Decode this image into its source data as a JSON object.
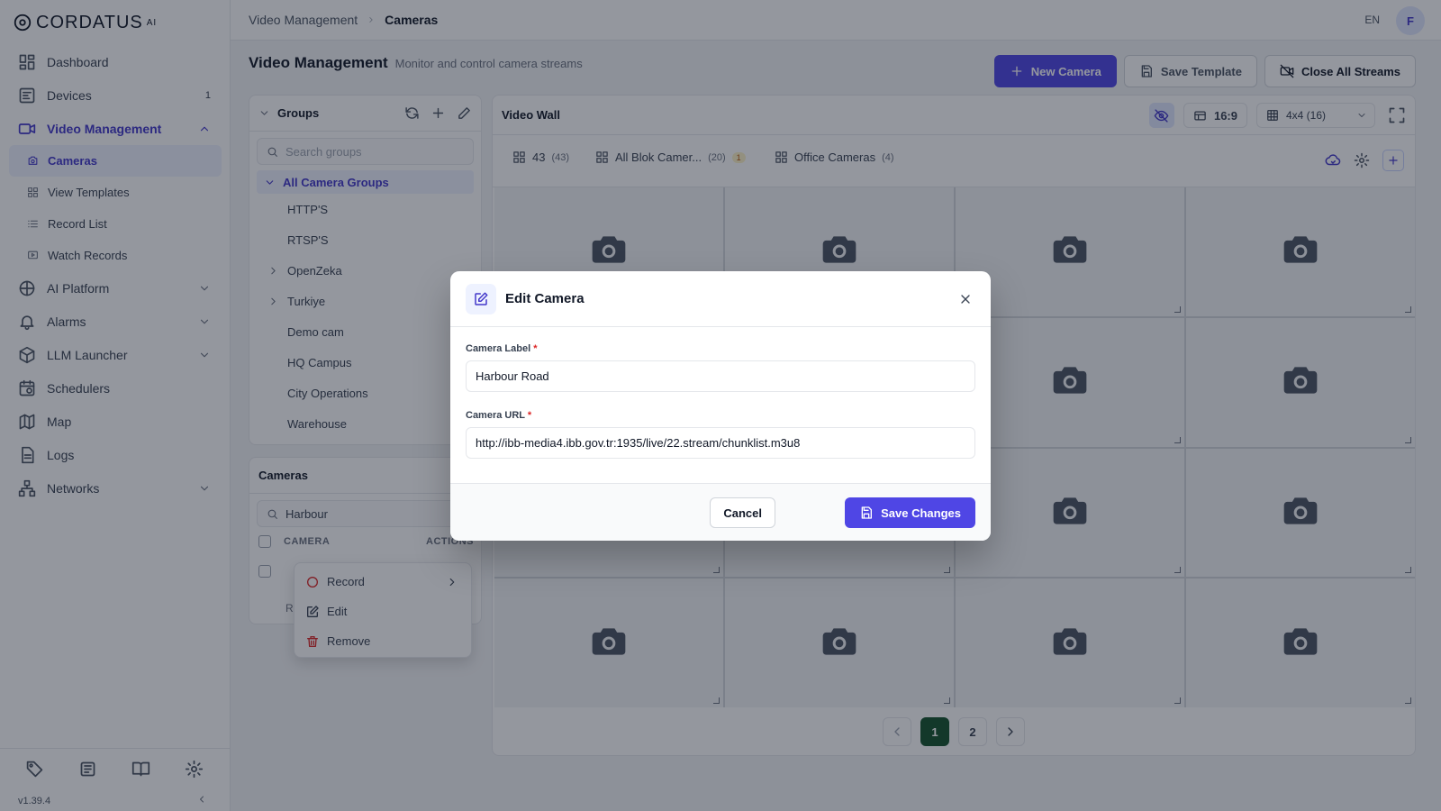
{
  "brand": {
    "name": "CORDATUS",
    "sup": "AI",
    "version": "v1.39.4"
  },
  "sidebar": {
    "items": [
      {
        "label": "Dashboard",
        "icon": "dashboard-icon"
      },
      {
        "label": "Devices",
        "icon": "devices-icon",
        "badge": "1"
      },
      {
        "label": "Video Management",
        "icon": "video-icon",
        "expanded": true,
        "children": [
          {
            "label": "Cameras",
            "icon": "camera-icon",
            "active": true
          },
          {
            "label": "View Templates",
            "icon": "grid-icon"
          },
          {
            "label": "Record List",
            "icon": "list-icon"
          },
          {
            "label": "Watch Records",
            "icon": "play-icon"
          }
        ]
      },
      {
        "label": "AI Platform",
        "icon": "brain-icon"
      },
      {
        "label": "Alarms",
        "icon": "bell-icon"
      },
      {
        "label": "LLM Launcher",
        "icon": "box-icon"
      },
      {
        "label": "Schedulers",
        "icon": "calendar-clock-icon"
      },
      {
        "label": "Map",
        "icon": "map-icon"
      },
      {
        "label": "Logs",
        "icon": "file-icon"
      },
      {
        "label": "Networks",
        "icon": "network-icon"
      }
    ]
  },
  "header": {
    "breadcrumb": [
      "Video Management",
      "Cameras"
    ],
    "lang": "EN",
    "avatar": "F"
  },
  "page": {
    "title": "Video Management",
    "subtitle": "Monitor and control camera streams",
    "actions": {
      "new_camera": "New Camera",
      "save_template": "Save Template",
      "close_all": "Close All Streams"
    }
  },
  "groups": {
    "title": "Groups",
    "search_placeholder": "Search groups",
    "all_label": "All Camera Groups",
    "items": [
      {
        "label": "HTTP'S",
        "expandable": false
      },
      {
        "label": "RTSP'S",
        "expandable": false
      },
      {
        "label": "OpenZeka",
        "expandable": true
      },
      {
        "label": "Turkiye",
        "expandable": true
      },
      {
        "label": "Demo cam",
        "expandable": false
      },
      {
        "label": "HQ Campus",
        "expandable": false
      },
      {
        "label": "City Operations",
        "expandable": false
      },
      {
        "label": "Warehouse",
        "expandable": false
      }
    ]
  },
  "cameras": {
    "title": "Cameras",
    "search_value": "Harbour",
    "col_camera": "CAMERA",
    "col_actions": "ACTIONS",
    "footer": "R"
  },
  "context_menu": {
    "record": "Record",
    "edit": "Edit",
    "remove": "Remove"
  },
  "wall": {
    "title": "Video Wall",
    "ratio": "16:9",
    "layout": "4x4 (16)",
    "tabs": [
      {
        "label": "43",
        "count": "(43)"
      },
      {
        "label": "All Blok Camer...",
        "count": "(20)",
        "badge": "1"
      },
      {
        "label": "Office Cameras",
        "count": "(4)"
      }
    ],
    "pages": [
      "1",
      "2"
    ],
    "current_page": "1"
  },
  "modal": {
    "title": "Edit Camera",
    "label_label": "Camera Label",
    "label_value": "Harbour Road",
    "url_label": "Camera URL",
    "url_value": "http://ibb-media4.ibb.gov.tr:1935/live/22.stream/chunklist.m3u8",
    "required_mark": "*",
    "cancel": "Cancel",
    "save": "Save Changes"
  },
  "colors": {
    "accent": "#4f46e5",
    "active_page": "#14532d",
    "danger": "#dc2626"
  }
}
